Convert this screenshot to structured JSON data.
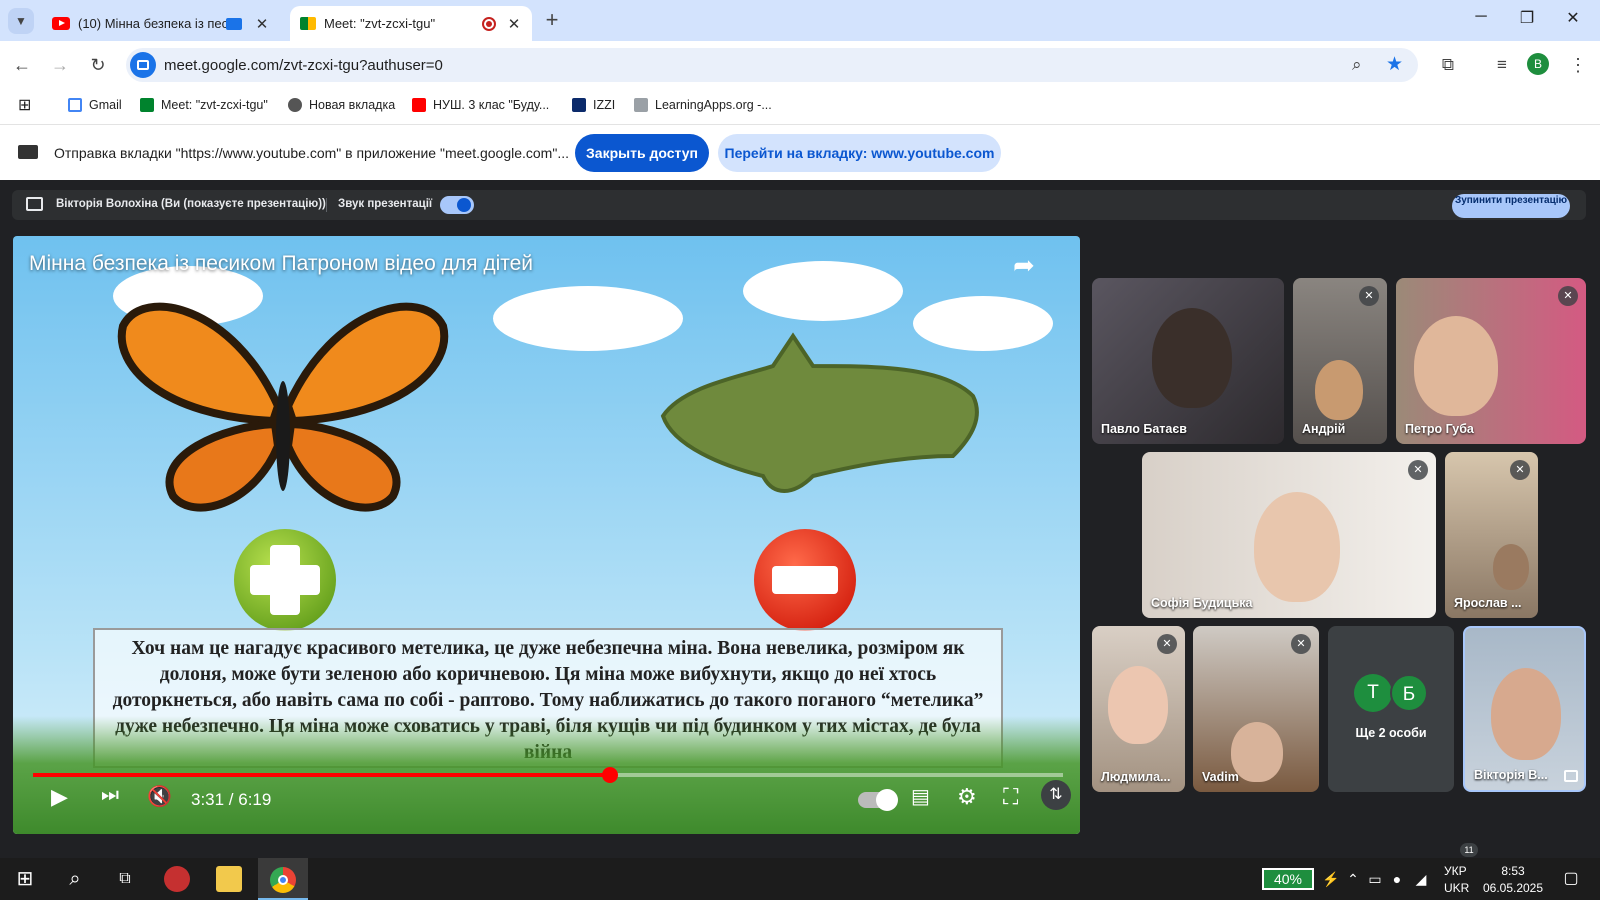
{
  "browser": {
    "tabs": [
      {
        "title": "(10) Мінна безпека із песи",
        "active": false
      },
      {
        "title": "Meet: \"zvt-zcxi-tgu\"",
        "active": true
      }
    ],
    "url": "meet.google.com/zvt-zcxi-tgu?authuser=0",
    "profile_initial": "B",
    "bookmarks": [
      "Gmail",
      "Meet: \"zvt-zcxi-tgu\"",
      "Новая вкладка",
      "НУШ. 3 клас \"Буду...",
      "IZZI",
      "LearningApps.org -..."
    ]
  },
  "share_bar": {
    "message": "Отправка вкладки \"https://www.youtube.com\" в приложение \"meet.google.com\"...",
    "stop_label": "Закрыть доступ",
    "switch_label": "Перейти на вкладку: www.youtube.com"
  },
  "presentation_bar": {
    "presenter": "Вікторія Волохіна (Ви (показуєте презентацію))",
    "audio_label": "Звук презентації",
    "stop_label": "Зупинити презентацію"
  },
  "video": {
    "title": "Мінна безпека із песиком Патроном відео для дітей",
    "caption": "Хоч нам це нагадує красивого метелика, це дуже небезпечна міна. Вона невелика, розміром як долоня, може бути зеленою або коричневою. Ця міна може вибухнути, якщо до неї хтось доторкнеться, або навіть сама по собі - раптово. Тому наближатись до такого поганого “метелика” дуже небезпечно. Ця міна може сховатись у траві, біля кущів чи під будинком у тих містах, де була війна",
    "time": "3:31 / 6:19",
    "progress": 0.56
  },
  "participants": [
    {
      "name": "Павло Батаєв"
    },
    {
      "name": "Андрій"
    },
    {
      "name": "Петро Губа"
    },
    {
      "name": "Софія Будицька"
    },
    {
      "name": "Ярослав ..."
    },
    {
      "name": "Людмила..."
    },
    {
      "name": "Vadim"
    },
    {
      "name": "Ще 2 особи",
      "initials": [
        "Т",
        "Б"
      ]
    },
    {
      "name": "Вікторія В..."
    }
  ],
  "taskbar": {
    "battery": "40%",
    "lang_top": "УКР",
    "lang_bottom": "UKR",
    "time": "8:53",
    "date": "06.05.2025",
    "badge": "11"
  }
}
